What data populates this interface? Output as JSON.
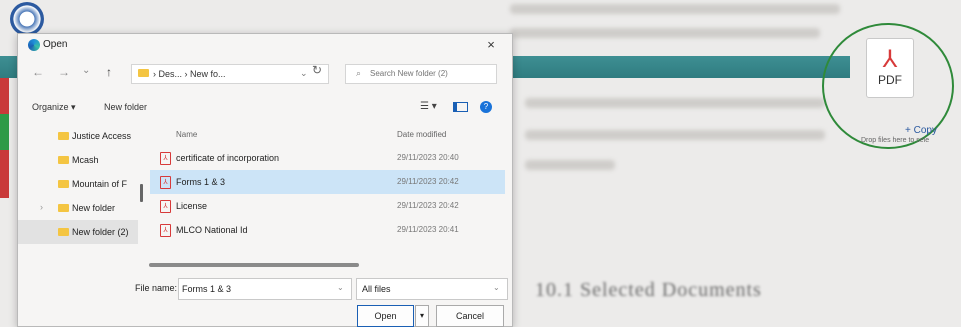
{
  "dialog": {
    "title": "Open",
    "close_glyph": "×",
    "nav": {
      "back_glyph": "←",
      "forward_glyph": "→",
      "recent_glyph": "⌄",
      "up_glyph": "↑",
      "path": "› Des... › New fo...",
      "path_dropdown_glyph": "⌄",
      "refresh_glyph": "↻",
      "search_icon_glyph": "⌕",
      "search_placeholder": "Search New folder (2)"
    },
    "toolbar": {
      "organize_label": "Organize ▾",
      "new_folder_label": "New folder",
      "view_glyph": "☰ ▾",
      "help_glyph": "?"
    },
    "sidebar": {
      "items": [
        {
          "label": "Justice Access",
          "chevron": ""
        },
        {
          "label": "Mcash",
          "chevron": ""
        },
        {
          "label": "Mountain of F",
          "chevron": ""
        },
        {
          "label": "New folder",
          "chevron": "›"
        },
        {
          "label": "New folder (2)",
          "chevron": ""
        }
      ],
      "selected_index": 4
    },
    "columns": {
      "name": "Name",
      "date_modified": "Date modified"
    },
    "files": [
      {
        "name": "certificate of incorporation",
        "date": "29/11/2023 20:40",
        "icon": "pdf-icon"
      },
      {
        "name": "Forms 1 & 3",
        "date": "29/11/2023 20:42",
        "icon": "pdf-icon"
      },
      {
        "name": "License",
        "date": "29/11/2023 20:42",
        "icon": "pdf-icon"
      },
      {
        "name": "MLCO National Id",
        "date": "29/11/2023 20:41",
        "icon": "pdf-icon"
      }
    ],
    "selected_file_index": 1,
    "pdf_glyph": "⅄",
    "file_name_label": "File name:",
    "file_name_value": "Forms 1 & 3",
    "dropdown_glyph": "⌄",
    "file_type_value": "All files",
    "open_label": "Open",
    "open_split_glyph": "▾",
    "cancel_label": "Cancel"
  },
  "pdf_widget": {
    "symbol": "⅄",
    "label": "PDF",
    "copy_label": "+ Copy",
    "drop_hint": "Drop files here to sele"
  },
  "background": {
    "heading": "10.1 Selected Documents"
  },
  "colors": {
    "teal_bar": "#3e8f93",
    "selection": "#cce4f7",
    "accent": "#1a5fb4",
    "pdf_red": "#d73a3a",
    "folder": "#f4c542",
    "circle": "#2f8a3a"
  }
}
